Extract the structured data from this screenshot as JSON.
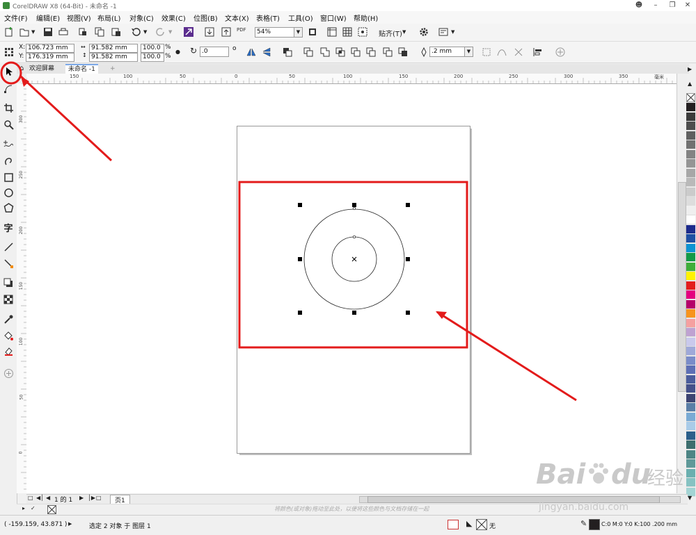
{
  "window": {
    "title": "CorelDRAW X8 (64-Bit) - 未命名 -1"
  },
  "menu": [
    "文件(F)",
    "编辑(E)",
    "视图(V)",
    "布局(L)",
    "对象(C)",
    "效果(C)",
    "位图(B)",
    "文本(X)",
    "表格(T)",
    "工具(O)",
    "窗口(W)",
    "帮助(H)"
  ],
  "toolbar": {
    "zoom": "54%",
    "snap_label": "贴齐(T)",
    "pdf_label": "PDF"
  },
  "properties": {
    "x_label": "X:",
    "x_value": "106.723 mm",
    "y_label": "Y:",
    "y_value": "176.319 mm",
    "width": "91.582 mm",
    "height": "91.582 mm",
    "scale_x": "100.0",
    "scale_y": "100.0",
    "percent": "%",
    "rotation": ".0",
    "degree": "o",
    "outline_width": ".2 mm"
  },
  "tabs": {
    "welcome": "欢迎屏幕",
    "document": "未命名 -1",
    "add": "+"
  },
  "ruler": {
    "h_ticks": [
      "150",
      "100",
      "50",
      "0",
      "50",
      "100",
      "150",
      "200",
      "250",
      "300",
      "350"
    ],
    "h_unit": "毫米",
    "v_ticks": [
      "300",
      "250",
      "200",
      "150",
      "100",
      "50",
      "0"
    ]
  },
  "pages": {
    "counter": "1 的 1",
    "page_tab": "页1"
  },
  "hint": "将颜色(或对象)拖动至此处，以便将这些颜色与文档存储在一起",
  "status": {
    "coords": "( -159.159, 43.871 )",
    "selection": "选定 2 对象 于 图层 1",
    "fill_none": "无",
    "color_info": "C:0 M:0 Y:0 K:100  .200 mm"
  },
  "watermark": {
    "brand": "Bai",
    "brand2": "du",
    "cn": "经验",
    "url": "jingyan.baidu.com"
  },
  "palette": [
    "#231f20",
    "#3b3b3b",
    "#4d4d4d",
    "#5f5f5f",
    "#717171",
    "#838383",
    "#959595",
    "#a7a7a7",
    "#b9b9b9",
    "#cbcbcb",
    "#dddddd",
    "#efefef",
    "#ffffff",
    "#1d2b8c",
    "#1f4fa3",
    "#0d93d2",
    "#139a47",
    "#3fae3a",
    "#fff200",
    "#e31d1d",
    "#e4007f",
    "#b5006a",
    "#f7941d",
    "#f5a0a0",
    "#bfa2d1",
    "#c9c9ec",
    "#9fa9d9",
    "#7a8cc9",
    "#5d6fb5",
    "#4a5c9c",
    "#44508a",
    "#3d4472",
    "#5b7ea6",
    "#7aaad4",
    "#a9cbe8",
    "#2c5f8a",
    "#3d6e6e",
    "#4d8585",
    "#5f9999",
    "#6aafaf",
    "#86c2c2",
    "#a3d4d4"
  ],
  "colors": {
    "selection_frame": "#e31b1b",
    "arrow": "#e31b1b"
  }
}
